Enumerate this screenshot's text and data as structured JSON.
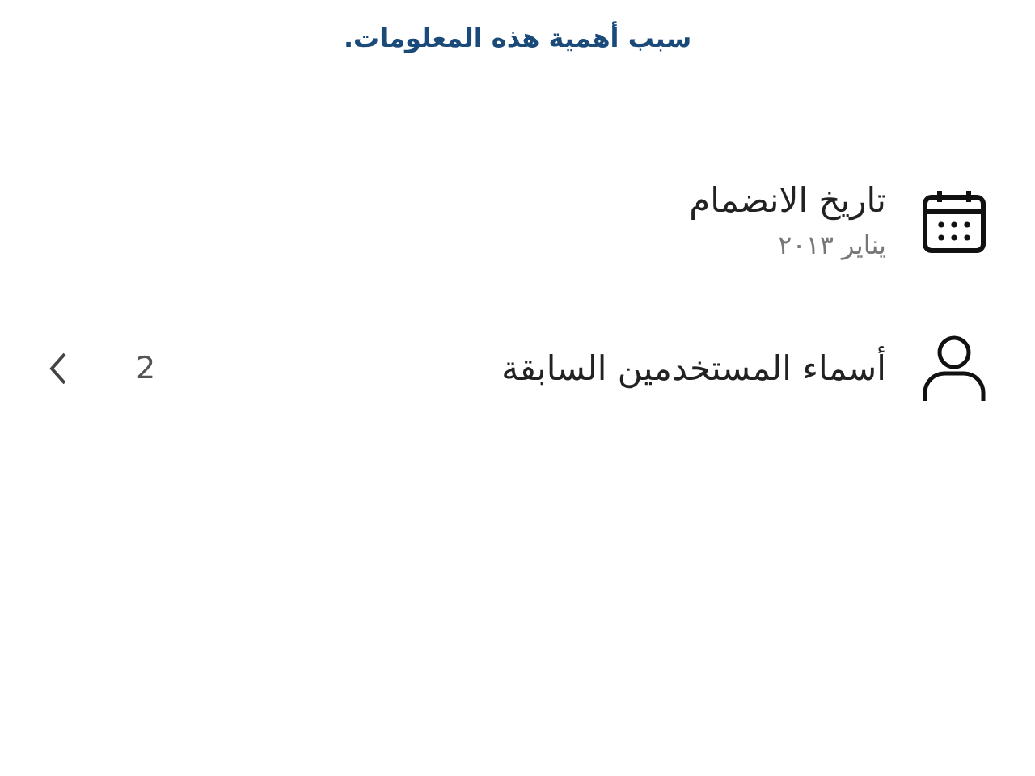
{
  "intro": {
    "link": "سبب أهمية هذه المعلومات."
  },
  "items": [
    {
      "kind": "date",
      "title": "تاريخ الانضمام",
      "subtitle": "يناير ٢٠١٣"
    },
    {
      "kind": "usernames",
      "title": "أسماء المستخدمين السابقة",
      "count": "2"
    }
  ]
}
